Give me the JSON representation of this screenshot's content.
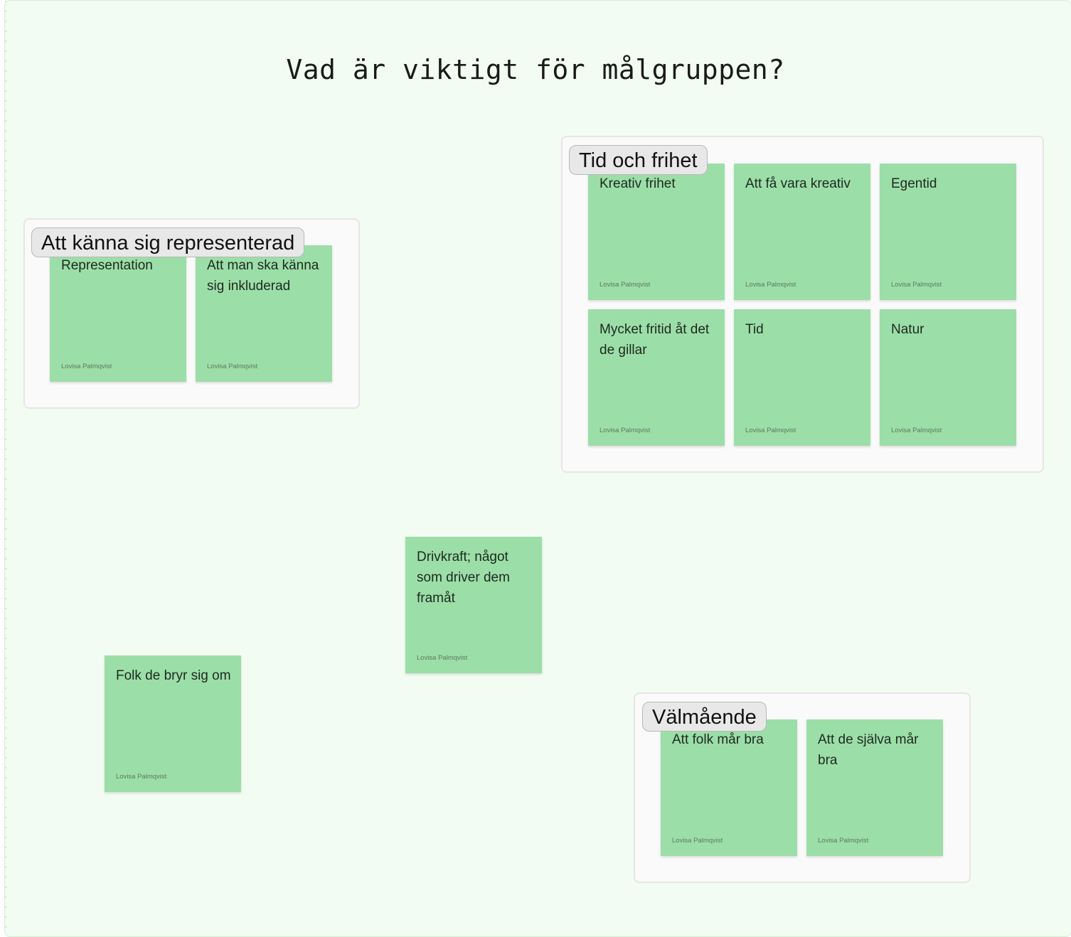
{
  "board": {
    "title": "Vad är viktigt för målgruppen?"
  },
  "sections": [
    {
      "label": "Att känna sig representerad",
      "notes": [
        {
          "text": "Representation",
          "author": "Lovisa Palmqvist"
        },
        {
          "text": "Att man ska känna sig inkluderad",
          "author": "Lovisa Palmqvist"
        }
      ]
    },
    {
      "label": "Tid och frihet",
      "notes": [
        {
          "text": "Kreativ frihet",
          "author": "Lovisa Palmqvist"
        },
        {
          "text": "Att få vara kreativ",
          "author": "Lovisa Palmqvist"
        },
        {
          "text": "Egentid",
          "author": "Lovisa Palmqvist"
        },
        {
          "text": "Mycket fritid åt det de gillar",
          "author": "Lovisa Palmqvist"
        },
        {
          "text": "Tid",
          "author": "Lovisa Palmqvist"
        },
        {
          "text": "Natur",
          "author": "Lovisa Palmqvist"
        }
      ]
    },
    {
      "label": "Välmående",
      "notes": [
        {
          "text": "Att folk mår bra",
          "author": "Lovisa Palmqvist"
        },
        {
          "text": "Att de själva mår bra",
          "author": "Lovisa Palmqvist"
        }
      ]
    }
  ],
  "loose_notes": [
    {
      "text": "Drivkraft; något som driver dem framåt",
      "author": "Lovisa Palmqvist"
    },
    {
      "text": "Folk de bryr sig om",
      "author": "Lovisa Palmqvist"
    }
  ],
  "colors": {
    "board_background": "#f2fcf2",
    "sticky": "#9cdea8",
    "section_background": "#fafafa",
    "section_label_background": "#e8e8e8"
  }
}
